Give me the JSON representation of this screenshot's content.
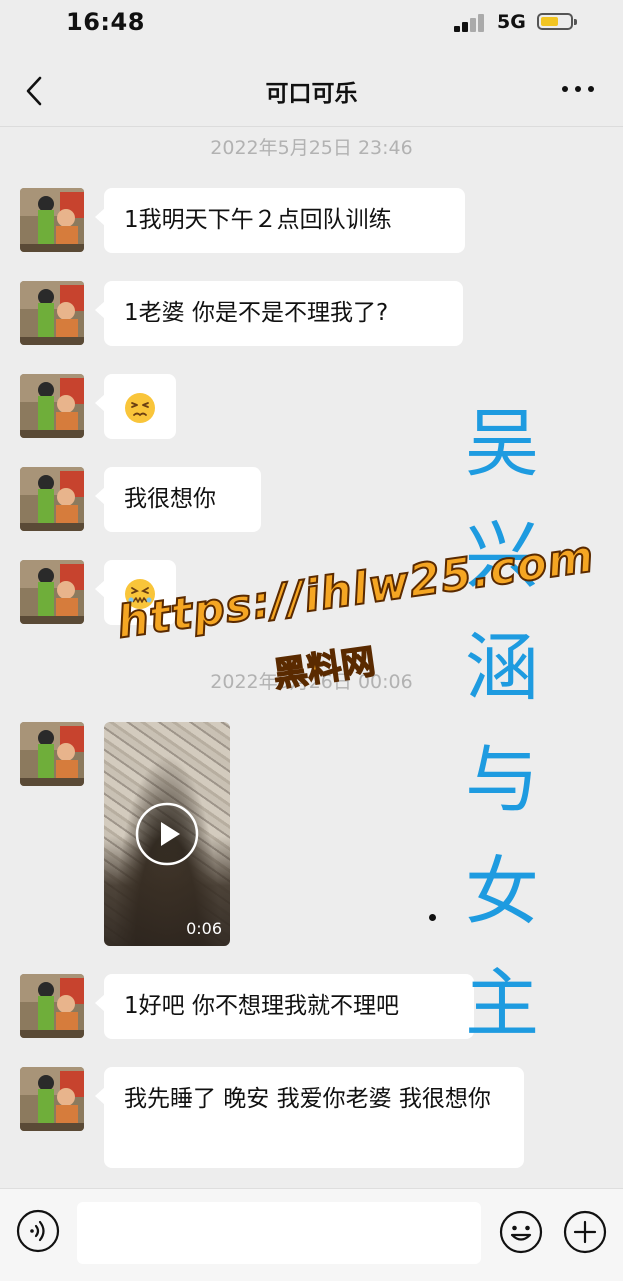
{
  "status_bar": {
    "time": "16:48",
    "network": "5G",
    "battery_level": 0.6
  },
  "nav": {
    "title": "可口可乐"
  },
  "chat": {
    "timestamps": [
      "2022年5月25日 23:46",
      "2022年5月26日 00:06"
    ],
    "messages": [
      {
        "type": "text",
        "text": "1我明天下午２点回队训练"
      },
      {
        "type": "text",
        "text": "1老婆 你是不是不理我了?"
      },
      {
        "type": "emoji",
        "emoji": "😣"
      },
      {
        "type": "text",
        "text": "我很想你"
      },
      {
        "type": "emoji",
        "emoji": "😖"
      },
      {
        "type": "video",
        "duration": "0:06"
      },
      {
        "type": "text",
        "text": "1好吧 你不想理我就不理吧"
      },
      {
        "type": "text",
        "text": "我先睡了 晚安 我爱你老婆 我很想你"
      }
    ]
  },
  "overlay": {
    "vertical_text": [
      "吴",
      "兴",
      "涵",
      "与",
      "女",
      "主"
    ],
    "watermark_url": "https://ihlw25.com",
    "watermark_site": "黑料网"
  },
  "colors": {
    "background": "#ededed",
    "bubble": "#ffffff",
    "overlay_blue": "#1e9be0",
    "watermark_orange": "#f5a623"
  }
}
